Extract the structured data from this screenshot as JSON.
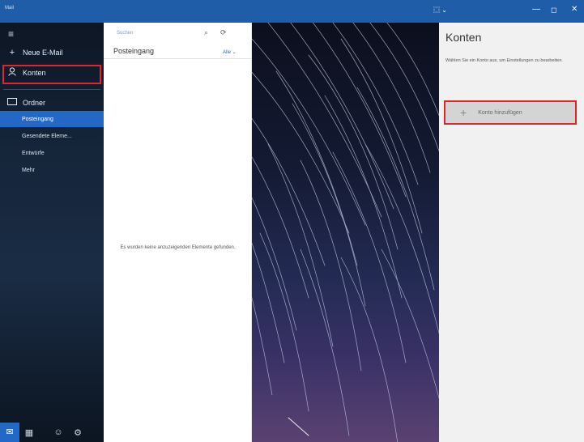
{
  "window": {
    "app_title": "Mail",
    "restore_label": "⿴ ⌄",
    "minimize": "—",
    "maximize": "◻",
    "close": "✕"
  },
  "nav": {
    "new_mail": "Neue E-Mail",
    "accounts": "Konten",
    "folders_heading": "Ordner",
    "folders": [
      {
        "label": "Posteingang",
        "active": true
      },
      {
        "label": "Gesendete Eleme..."
      },
      {
        "label": "Entwürfe"
      },
      {
        "label": "Mehr"
      }
    ]
  },
  "list": {
    "search_placeholder": "Suchen",
    "inbox_title": "Posteingang",
    "filter_label": "Alle ⌄",
    "empty_message": "Es wurden keine anzuzeigenden Elemente gefunden."
  },
  "accounts_pane": {
    "title": "Konten",
    "description": "Wählen Sie ein Konto aus, um Einstellungen zu bearbeiten.",
    "add_account_label": "Konto hinzufügen"
  },
  "colors": {
    "titlebar": "#1f5da8",
    "accent": "#2468c5",
    "highlight": "#e0262d"
  }
}
